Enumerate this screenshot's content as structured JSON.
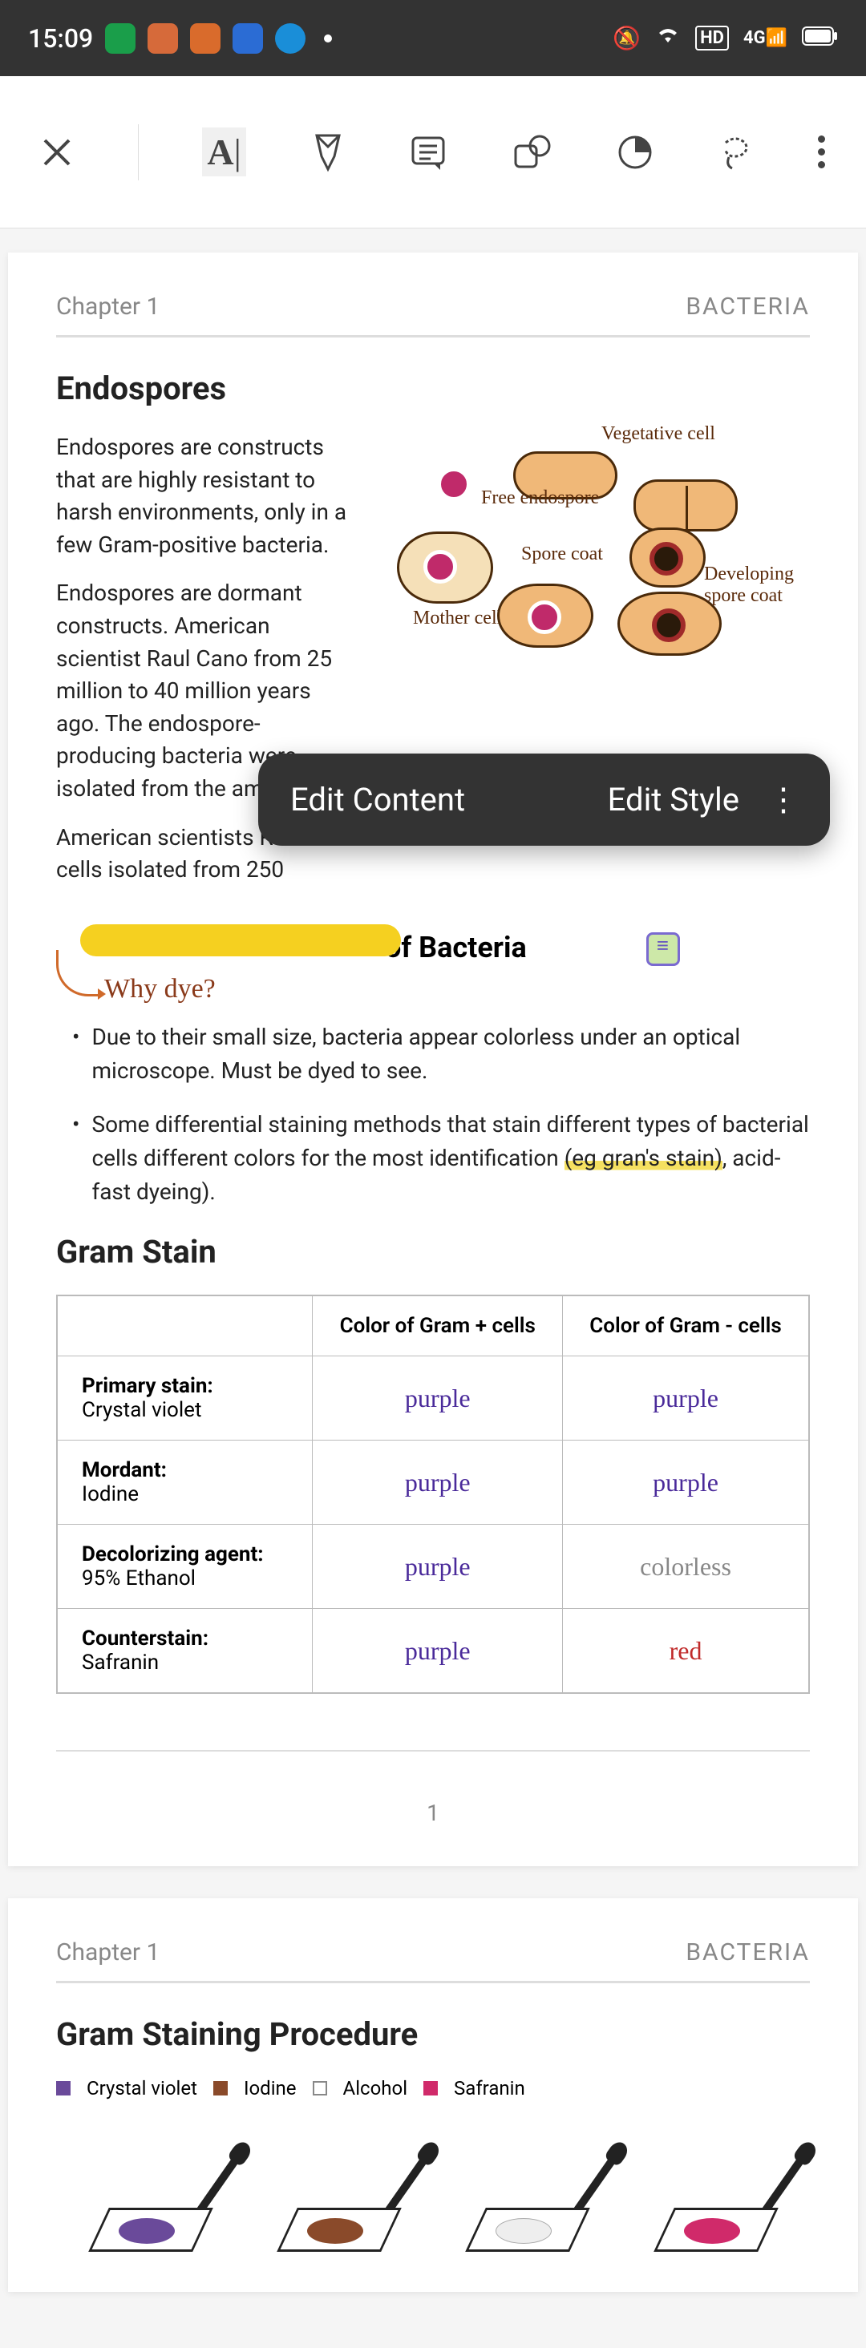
{
  "status": {
    "time": "15:09",
    "indicators": {
      "hd": "HD",
      "net": "4G"
    }
  },
  "popover": {
    "edit_content": "Edit Content",
    "edit_style": "Edit Style"
  },
  "page1": {
    "chapter": "Chapter 1",
    "subject": "BACTERIA",
    "h_endospores": "Endospores",
    "p1": "Endospores are constructs that are highly resistant to harsh environments, only in a few Gram-positive bacteria.",
    "p2": "Endospores are dormant constructs. American scientist Raul Cano from 25 million to 40 million years ago. The endospore-producing bacteria were isolated from the amber bee.",
    "p3": "American scientists R",
    "p4": "cells isolated from 250",
    "diag": {
      "veg": "Vegetative cell",
      "free": "Free endospore",
      "spore": "Spore coat",
      "dev": "Developing spore coat",
      "mother": "Mother cell"
    },
    "title_partial": "of Bacteria",
    "annotation": "Why dye?",
    "b1": "Due to their small size, bacteria appear colorless under an optical microscope. Must be dyed to see.",
    "b2a": "Some differential staining methods that stain different types of bacterial cells different colors for the most identification ",
    "b2b": "(eg gran's stain)",
    "b2c": ", acid-fast dyeing).",
    "h_gram": "Gram Stain",
    "table": {
      "h1": "Color of Gram + cells",
      "h2": "Color of Gram - cells",
      "r1": {
        "label": "Primary stain:",
        "sub": "Crystal violet",
        "plus": "purple",
        "minus": "purple"
      },
      "r2": {
        "label": "Mordant:",
        "sub": "Iodine",
        "plus": "purple",
        "minus": "purple"
      },
      "r3": {
        "label": "Decolorizing agent:",
        "sub": "95% Ethanol",
        "plus": "purple",
        "minus": "colorless"
      },
      "r4": {
        "label": "Counterstain:",
        "sub": "Safranin",
        "plus": "purple",
        "minus": "red"
      }
    },
    "page_num": "1"
  },
  "page2": {
    "chapter": "Chapter 1",
    "subject": "BACTERIA",
    "h_proc": "Gram Staining Procedure",
    "legend": {
      "cv": "Crystal violet",
      "io": "Iodine",
      "al": "Alcohol",
      "sa": "Safranin"
    }
  }
}
